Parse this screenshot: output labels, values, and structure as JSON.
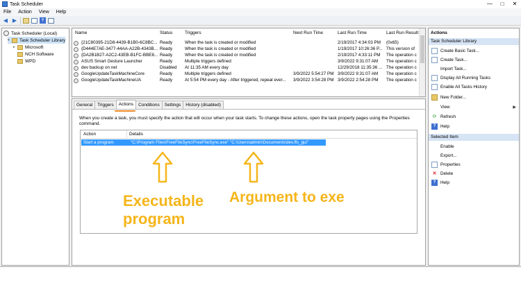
{
  "window": {
    "title": "Task Scheduler",
    "controls": [
      "—",
      "□",
      "✕"
    ]
  },
  "menu": [
    "File",
    "Action",
    "View",
    "Help"
  ],
  "tree": {
    "root": "Task Scheduler (Local)",
    "library": "Task Scheduler Library",
    "children": [
      "Microsoft",
      "NCH Software",
      "WPD"
    ]
  },
  "tasks": {
    "columns": [
      "Name",
      "Status",
      "Triggers",
      "Next Run Time",
      "Last Run Time",
      "Last Run Result"
    ],
    "rows": [
      {
        "name": "{21C80395-21D8-4439-B1B0-6C8BC...",
        "status": "Ready",
        "triggers": "When the task is created or modified",
        "next": "",
        "last": "2/19/2017 4:34:03 PM",
        "result": "(0x65)"
      },
      {
        "name": "{D444E7AE-3477-44AA-A22B-4343B...",
        "status": "Ready",
        "triggers": "When the task is created or modified",
        "next": "",
        "last": "1/19/2017 10:26:36 P...",
        "result": "This version of"
      },
      {
        "name": "{DA2B1B27-A2C2-43EB-B1FC-BBE8...",
        "status": "Ready",
        "triggers": "When the task is created or modified",
        "next": "",
        "last": "2/19/2017 4:33:11 PM",
        "result": "The operation c"
      },
      {
        "name": "ASUS Smart Gesture Launcher",
        "status": "Ready",
        "triggers": "Multiple triggers defined",
        "next": "",
        "last": "3/9/2022 9:31:07 AM",
        "result": "The operation c"
      },
      {
        "name": "dev backup on net",
        "status": "Disabled",
        "triggers": "At 11:35 AM every day",
        "next": "",
        "last": "12/29/2018 11:35:36 ...",
        "result": "The operation c"
      },
      {
        "name": "GoogleUpdateTaskMachineCore",
        "status": "Ready",
        "triggers": "Multiple triggers defined",
        "next": "3/9/2022 5:54:27 PM",
        "last": "3/9/2022 9:31:07 AM",
        "result": "The operation c"
      },
      {
        "name": "GoogleUpdateTaskMachineUA",
        "status": "Ready",
        "triggers": "At 5:54 PM every day - After triggered, repeat ever...",
        "next": "3/9/2022 3:54:28 PM",
        "last": "3/9/2022 2:54:28 PM",
        "result": "The operation c"
      }
    ]
  },
  "tabs": [
    "General",
    "Triggers",
    "Actions",
    "Conditions",
    "Settings",
    "History (disabled)"
  ],
  "actions_tab": {
    "description": "When you create a task, you must specify the action that will occur when your task starts.  To change these actions, open the task property pages using the Properties command.",
    "columns": [
      "Action",
      "Details"
    ],
    "row": {
      "action": "Start a program",
      "details": "\"C:\\Program Files\\FreeFileSync\\FreeFileSync.exe\" \"C:\\Users\\admin\\Documents\\dev.ffs_gui\""
    }
  },
  "annotations": {
    "exe_label_line1": "Executable",
    "exe_label_line2": "program",
    "arg_label": "Argument to exe",
    "color": "#f5b51a",
    "underline_color": "#f08a24"
  },
  "actions_pane": {
    "title": "Actions",
    "section1": "Task Scheduler Library",
    "items1": [
      "Create Basic Task...",
      "Create Task...",
      "Import Task...",
      "Display All Running Tasks",
      "Enable All Tasks History",
      "New Folder...",
      "View",
      "Refresh",
      "Help"
    ],
    "section2": "Selected Item",
    "items2": [
      "Enable",
      "Export...",
      "Properties",
      "Delete",
      "Help"
    ]
  }
}
